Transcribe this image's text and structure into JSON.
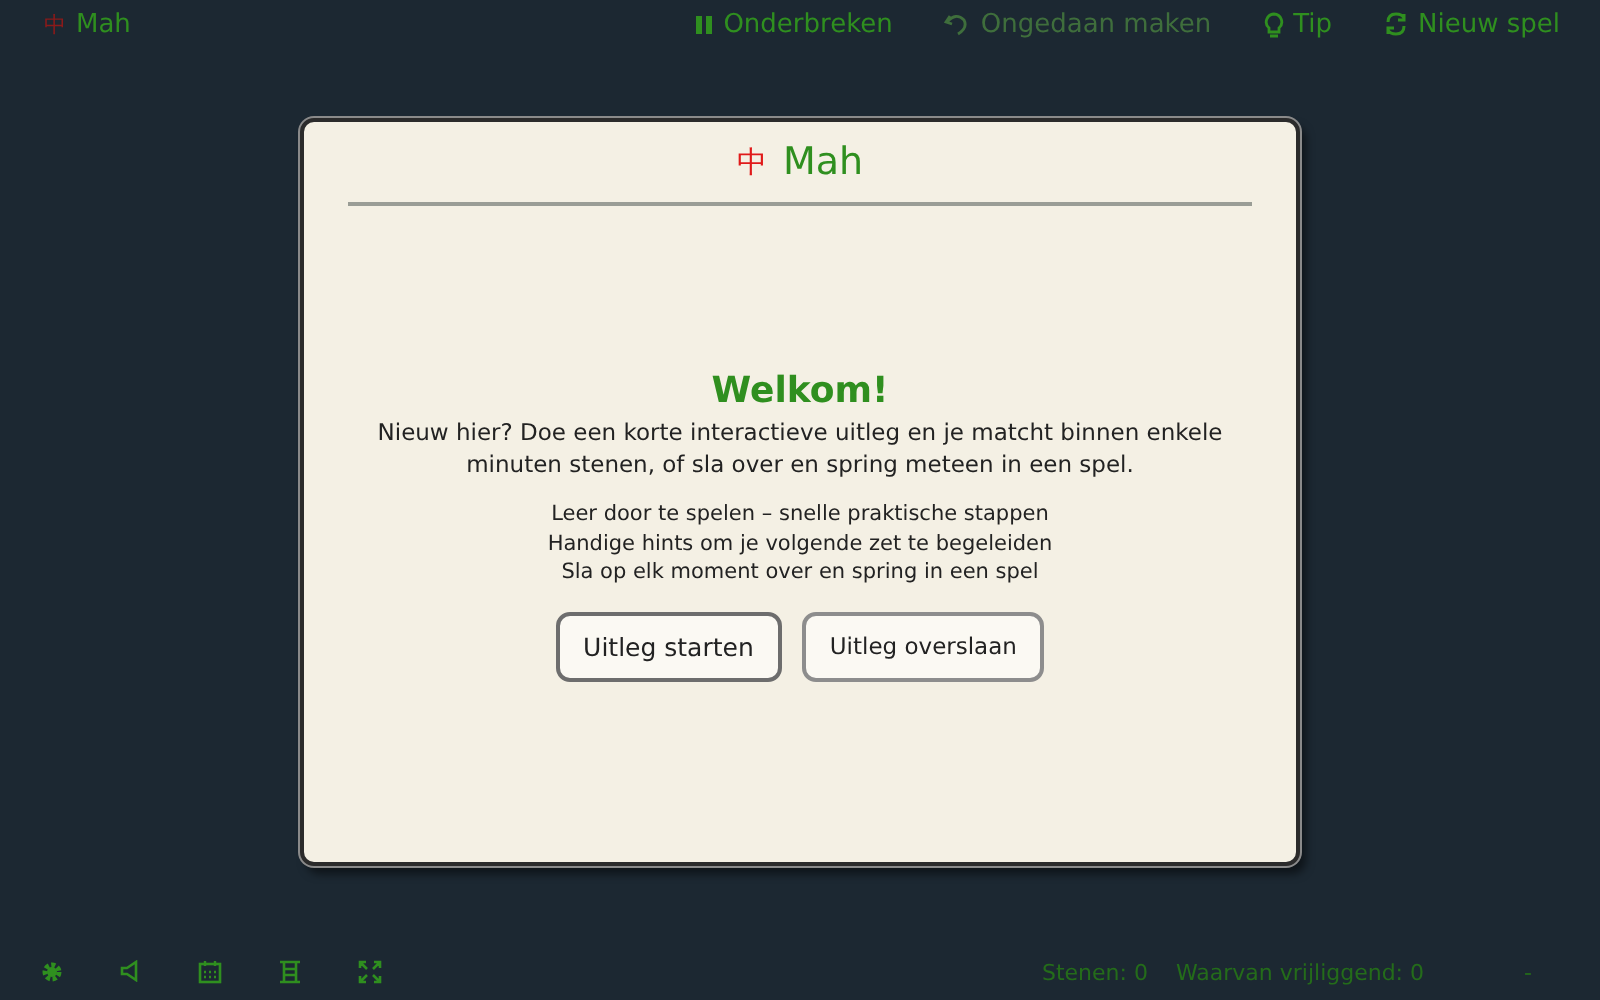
{
  "top_bar": {
    "logo_glyph": "中",
    "title": "Mah",
    "actions": [
      {
        "kind": "pause",
        "label": "Onderbreken",
        "disabled": false
      },
      {
        "kind": "undo",
        "label": "Ongedaan maken",
        "disabled": true
      },
      {
        "kind": "hint",
        "label": "Tip",
        "disabled": false
      },
      {
        "kind": "new",
        "label": "Nieuw spel",
        "disabled": false
      }
    ]
  },
  "dialog": {
    "logo_glyph": "中",
    "title": "Mah",
    "heading": "Welkom!",
    "intro": "Nieuw hier? Doe een korte interactieve uitleg en je matcht binnen enkele minuten stenen, of sla over en spring meteen in een spel.",
    "points": [
      "Leer door te spelen – snelle praktische stappen",
      "Handige hints om je volgende zet te begeleiden",
      "Sla op elk moment over en spring in een spel"
    ],
    "buttons": [
      {
        "label": "Uitleg starten",
        "selected": true
      },
      {
        "label": "Uitleg overslaan",
        "selected": false
      }
    ]
  },
  "bottom_bar": {
    "tools": [
      {
        "kind": "settings"
      },
      {
        "kind": "sound"
      },
      {
        "kind": "calendar"
      },
      {
        "kind": "layout"
      },
      {
        "kind": "fullscreen"
      }
    ],
    "stats": [
      "Stenen: 0",
      "Waarvan vrijliggend: 0"
    ],
    "extra": "-"
  }
}
